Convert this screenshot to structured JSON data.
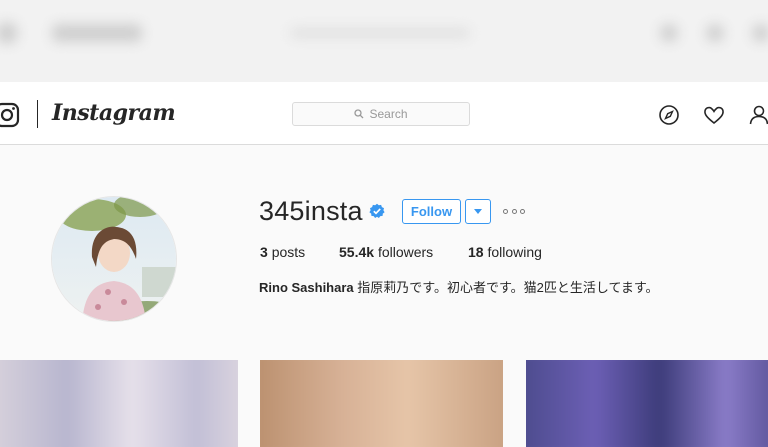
{
  "header": {
    "brand": "Instagram",
    "search_placeholder": "Search"
  },
  "profile": {
    "username": "345insta",
    "verified": true,
    "follow_label": "Follow",
    "stats": {
      "posts_count": "3",
      "posts_label": "posts",
      "followers_count": "55.4k",
      "followers_label": "followers",
      "following_count": "18",
      "following_label": "following"
    },
    "bio_name": "Rino Sashihara",
    "bio_text": "指原莉乃です。初心者です。猫2匹と生活してます。"
  },
  "colors": {
    "accent": "#3897f0",
    "verified": "#3897f0",
    "text": "#262626",
    "border": "#dbdbdb"
  },
  "icons": [
    "instagram-logo-icon",
    "search-icon",
    "compass-icon",
    "heart-icon",
    "person-icon",
    "verified-badge-icon",
    "chevron-down-icon",
    "more-options-icon"
  ]
}
